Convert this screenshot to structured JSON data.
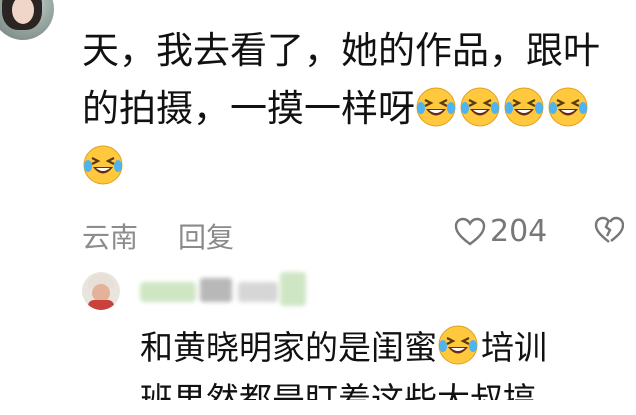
{
  "comment": {
    "line1": "天，我去看了，她的作品，跟叶",
    "line2": "的拍摄，一摸一样呀",
    "emoji_name": "laughing-crying-emoji",
    "location": "云南",
    "reply_label": "回复",
    "like_count": "204"
  },
  "reply": {
    "line1_a": "和黄晓明家的是闺蜜",
    "line1_b": "培训",
    "line2": "班果然都是盯着这些大叔搞"
  },
  "colors": {
    "text": "#111111",
    "meta": "#8d8d8d",
    "emoji_face": "#ffc83d"
  }
}
